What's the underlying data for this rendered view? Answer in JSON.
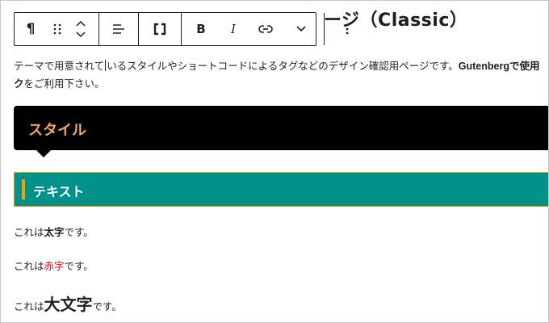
{
  "page_title": "ージ（Classic）",
  "toolbar": {
    "paragraph_icon": "¶",
    "bold_label": "B",
    "italic_label": "I"
  },
  "intro": {
    "line1_a": "テーマで用意されて",
    "line1_b": "いるスタイルやショートコードによるタグなどのデザイン確認用ページです。",
    "line1_bold": "Gutenbergで使用",
    "line2_bold": "ク",
    "line2_rest": "をご利用下さい。"
  },
  "sections": {
    "style_heading": "スタイル",
    "text_heading": "テキスト"
  },
  "paragraphs": {
    "p1_pre": "これは",
    "p1_em": "太字",
    "p1_post": "です。",
    "p2_pre": "これは",
    "p2_em": "赤字",
    "p2_post": "です。",
    "p3_pre": "これは",
    "p3_em": "大文字",
    "p3_post": "です。"
  },
  "colors": {
    "style_heading_bg": "#000000",
    "style_heading_text": "#f0a95c",
    "text_heading_bg": "#00918b",
    "text_heading_accent": "#f5a300",
    "red_text": "#e60012"
  }
}
